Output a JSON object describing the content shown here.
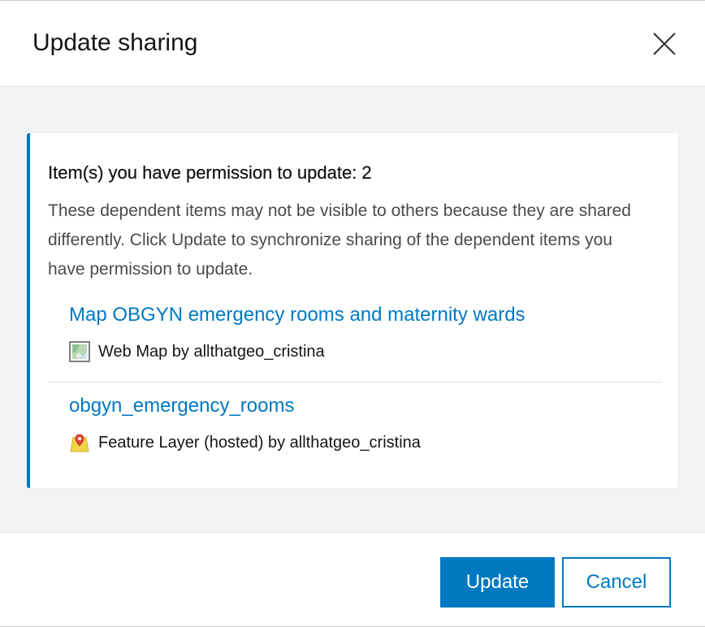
{
  "dialog": {
    "title": "Update sharing",
    "close_icon": "close-icon"
  },
  "card": {
    "heading": "Item(s) you have permission to update: 2",
    "description": "These dependent items may not be visible to others because they are shared differently. Click Update to synchronize sharing of the dependent items you have permission to update.",
    "accent_color": "#0079c1",
    "items": [
      {
        "title": "Map OBGYN emergency rooms and maternity wards",
        "meta": "Web Map by allthatgeo_cristina",
        "icon": "web-map-icon"
      },
      {
        "title": "obgyn_emergency_rooms",
        "meta": "Feature Layer (hosted) by allthatgeo_cristina",
        "icon": "feature-layer-icon"
      }
    ]
  },
  "footer": {
    "update_label": "Update",
    "cancel_label": "Cancel"
  }
}
